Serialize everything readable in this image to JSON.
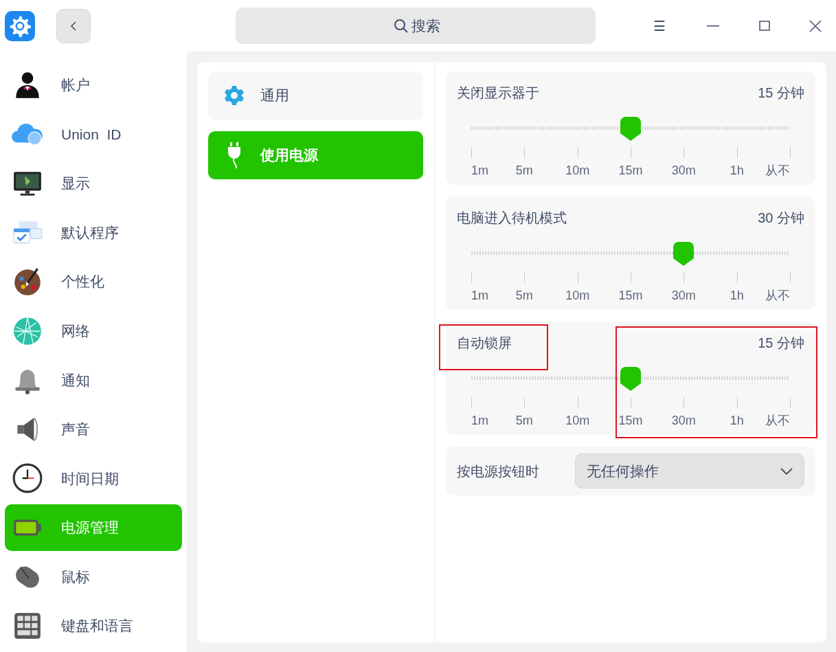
{
  "search": {
    "placeholder": "搜索"
  },
  "title_bar": {
    "menu_glyph": "☰"
  },
  "sidebar": {
    "items": [
      {
        "label": "帐户",
        "selected": false
      },
      {
        "label": "Union  ID",
        "selected": false
      },
      {
        "label": "显示",
        "selected": false
      },
      {
        "label": "默认程序",
        "selected": false
      },
      {
        "label": "个性化",
        "selected": false
      },
      {
        "label": "网络",
        "selected": false
      },
      {
        "label": "通知",
        "selected": false
      },
      {
        "label": "声音",
        "selected": false
      },
      {
        "label": "时间日期",
        "selected": false
      },
      {
        "label": "电源管理",
        "selected": true
      },
      {
        "label": "鼠标",
        "selected": false
      },
      {
        "label": "键盘和语言",
        "selected": false
      }
    ]
  },
  "sections": [
    {
      "label": "通用",
      "selected": false
    },
    {
      "label": "使用电源",
      "selected": true
    }
  ],
  "settings": [
    {
      "kind": "slider",
      "label": "关闭显示器于",
      "reading": "15 分钟",
      "level": 0.5,
      "highlighted": false,
      "ticks": [
        "1m",
        "5m",
        "10m",
        "15m",
        "30m",
        "1h",
        "从不"
      ]
    },
    {
      "kind": "slider",
      "label": "电脑进入待机模式",
      "reading": "30 分钟",
      "level": 0.6667,
      "highlighted": false,
      "ticks": [
        "1m",
        "5m",
        "10m",
        "15m",
        "30m",
        "1h",
        "从不"
      ]
    },
    {
      "kind": "slider",
      "label": "自动锁屏",
      "reading": "15 分钟",
      "level": 0.5,
      "highlighted": true,
      "ticks": [
        "1m",
        "5m",
        "10m",
        "15m",
        "30m",
        "1h",
        "从不"
      ]
    },
    {
      "kind": "dropdown",
      "label": "按电源按钮时",
      "value": "无任何操作"
    }
  ]
}
